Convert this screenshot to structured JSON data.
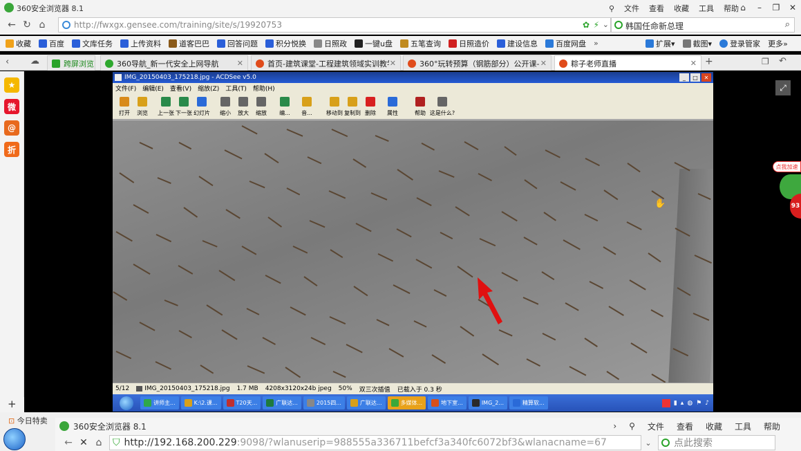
{
  "browser": {
    "title": "360安全浏览器 8.1",
    "menu": [
      "文件",
      "查看",
      "收藏",
      "工具",
      "帮助"
    ],
    "url": "http://fwxgx.gensee.com/training/site/s/19920753",
    "search_value": "韩国任命新总理",
    "bookmarks": [
      "收藏",
      "百度",
      "文库任务",
      "上传资料",
      "道客巴巴",
      "回答问题",
      "积分悦换",
      "日照政",
      "一键u盘",
      "五笔查询",
      "日照造价",
      "建设信息",
      "百度网盘"
    ],
    "bookmarks_right": [
      "扩展",
      "截图",
      "登录管家",
      "更多"
    ],
    "bookmark_icon_colors": [
      "#f0a21a",
      "#2b5fd9",
      "#2b5fd9",
      "#2b5fd9",
      "#8a5a1a",
      "#2b5fd9",
      "#2b5fd9",
      "#888",
      "#222",
      "#c08a20",
      "#d02020",
      "#2b5fd9",
      "#2b7ad9"
    ],
    "tabs": [
      {
        "label": "跨屏浏览",
        "icon_color": "#29a329"
      },
      {
        "label": "360导航_新一代安全上网导航",
        "icon_color": "#2ea82e"
      },
      {
        "label": "首页-建筑课堂-工程建筑领域实训教学",
        "icon_color": "#e04b1b"
      },
      {
        "label": "360°玩转预算（钢筋部分）公开课-粽",
        "icon_color": "#e04b1b"
      },
      {
        "label": "粽子老师直播",
        "icon_color": "#e04b1b"
      }
    ],
    "sidebar_icons": [
      {
        "name": "favorites-icon",
        "glyph": "★",
        "color": "#f5b800"
      },
      {
        "name": "weibo-icon",
        "glyph": "微",
        "color": "#e6162d"
      },
      {
        "name": "mail-icon",
        "glyph": "@",
        "color": "#e86a1e"
      },
      {
        "name": "discount-icon",
        "glyph": "折",
        "color": "#f06a1a"
      }
    ]
  },
  "acdsee": {
    "title": "IMG_20150403_175218.jpg - ACDSee v5.0",
    "menu": [
      "文件(F)",
      "编辑(E)",
      "查看(V)",
      "缩放(Z)",
      "工具(T)",
      "帮助(H)"
    ],
    "toolbar": [
      {
        "label": "打开",
        "color": "#d88a1a"
      },
      {
        "label": "浏览",
        "color": "#d8a01a"
      },
      {
        "label": "上一张",
        "color": "#2a8a4a"
      },
      {
        "label": "下一张",
        "color": "#2a8a4a"
      },
      {
        "label": "幻灯片",
        "color": "#2a6ad8"
      },
      {
        "label": "缩小",
        "color": "#666"
      },
      {
        "label": "放大",
        "color": "#666"
      },
      {
        "label": "缩放",
        "color": "#666"
      },
      {
        "label": "编...",
        "color": "#2a8a4a"
      },
      {
        "label": "音...",
        "color": "#d8a01a"
      },
      {
        "label": "移动到",
        "color": "#d8a01a"
      },
      {
        "label": "复制到",
        "color": "#d8a01a"
      },
      {
        "label": "删除",
        "color": "#d82020"
      },
      {
        "label": "属性",
        "color": "#2a6ad8"
      },
      {
        "label": "帮助",
        "color": "#b02020"
      },
      {
        "label": "这是什么?",
        "color": "#666"
      }
    ],
    "status": {
      "index": "5/12",
      "file": "IMG_20150403_175218.jpg",
      "size": "1.7 MB",
      "dims": "4208x3120x24b jpeg",
      "zoom": "50%",
      "mode": "双三次插值",
      "loaded": "已载入于 0.3 秒"
    },
    "taskbar": [
      {
        "label": "讲师主..."
      },
      {
        "label": "K:\\2.课..."
      },
      {
        "label": "T20天..."
      },
      {
        "label": "广联达..."
      },
      {
        "label": "2015四..."
      },
      {
        "label": "广联达..."
      },
      {
        "label": "多媒体..."
      },
      {
        "label": "地下室..."
      },
      {
        "label": "IMG_2..."
      },
      {
        "label": "精算软..."
      }
    ]
  },
  "overlay": {
    "side_badge": "点我加速",
    "side_number": "93"
  },
  "bottom": {
    "todays_deals": "今日特卖",
    "inner_title": "360安全浏览器 8.1",
    "inner_menu": [
      "文件",
      "查看",
      "收藏",
      "工具",
      "帮助"
    ],
    "inner_url_host": "http://192.168.200.229",
    "inner_url_rest": ":9098/?wlanuserip=988555a336711befcf3a340fc6072bf3&wlanacname=67",
    "inner_search_placeholder": "点此搜索"
  }
}
